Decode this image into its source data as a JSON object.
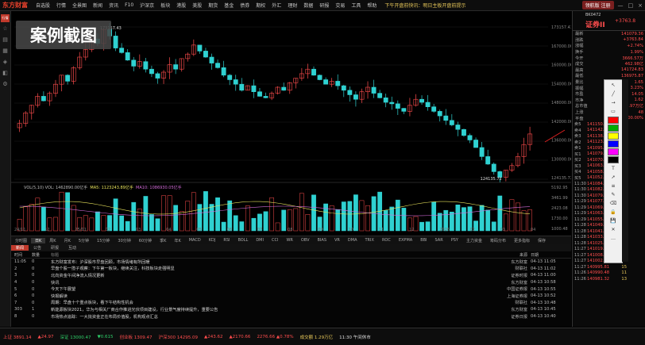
{
  "app": {
    "logo": "东方财富",
    "window_buttons": [
      "—",
      "□",
      "×"
    ],
    "brand_button": "领航版 注册",
    "ticker_text": "下午开盘前快讯：明日主板开盘前提示"
  },
  "menu": [
    "自选股",
    "行情",
    "全景图",
    "新闻",
    "资讯",
    "F10",
    "沪深京",
    "板块",
    "港股",
    "美股",
    "期货",
    "基金",
    "债券",
    "期权",
    "外汇",
    "理财",
    "数据",
    "研报",
    "交易",
    "工具",
    "帮助"
  ],
  "overlay": {
    "label": "案例截图"
  },
  "sidebar": {
    "active_icon": "行情"
  },
  "chart": {
    "high_label": "173157.43",
    "low_label": "124135.72",
    "volume_legend": {
      "v1": "VOL(5,10)  VOL: 1462890.00亿手",
      "v2": "MA5: 1123243.89亿手",
      "v3": "MA10: 1086930.05亿手"
    },
    "price_ticks": [
      "173157.43",
      "167000.00",
      "160000.00",
      "154000.00",
      "148000.00",
      "142000.00",
      "136000.00",
      "130000.00",
      "124135.72"
    ],
    "volume_ticks": [
      "5192.95",
      "3461.99",
      "2423.08",
      "1730.00",
      "1000.48"
    ],
    "date_ticks": [
      "24/11",
      "12",
      "25/01",
      "02",
      "03",
      "04",
      "05",
      "06",
      "07",
      "08",
      "09",
      "10",
      "11",
      "12",
      "2026",
      "02",
      "03",
      "04"
    ]
  },
  "chart_data": {
    "type": "candlestick",
    "title": "",
    "xlabel": "",
    "ylabel": "",
    "ylim": [
      124000,
      174000
    ],
    "annotations": {
      "high": 173157.43,
      "low": 124135.72
    },
    "ohlc_close_series": [
      142000,
      145500,
      148000,
      151000,
      149500,
      152000,
      155000,
      158000,
      156000,
      160500,
      164000,
      166500,
      170000,
      168500,
      173157,
      171000,
      167000,
      165500,
      163000,
      161000,
      162500,
      160000,
      158500,
      157000,
      159000,
      161500,
      160000,
      163500,
      165000,
      168000,
      166000,
      164000,
      162000,
      160500,
      158000,
      156500,
      155000,
      153000,
      154500,
      152500,
      151000,
      150500,
      152000,
      154000,
      153000,
      155500,
      157000,
      158500,
      160000,
      158000,
      156500,
      155000,
      156000,
      154500,
      153000,
      151500,
      150000,
      152500,
      154000,
      152000,
      150500,
      149000,
      148500,
      147000,
      146000,
      148000,
      150000,
      149000,
      147500,
      146000,
      144500,
      143000,
      141500,
      140000,
      138000,
      136500,
      134000,
      131000,
      128500,
      126000,
      124136,
      126500,
      128000,
      131000,
      135000,
      138500
    ]
  },
  "chart_tabs": [
    "分时图",
    "日K",
    "周K",
    "月K",
    "5分钟",
    "15分钟",
    "30分钟",
    "60分钟",
    "季K",
    "年K",
    "MACD",
    "KDJ",
    "RSI",
    "BOLL",
    "DMI",
    "CCI",
    "WR",
    "OBV",
    "BIAS",
    "VR",
    "DMA",
    "TRIX",
    "ROC",
    "EXPMA",
    "BBI",
    "SAR",
    "PSY",
    "主力资金",
    "筹码分布",
    "更多指标",
    "保存"
  ],
  "news": {
    "tabs": [
      "新闻",
      "公告",
      "研报",
      "互动"
    ],
    "headers": {
      "time": "时间",
      "count": "数量",
      "title": "标题",
      "source": "来源",
      "date": "日期"
    },
    "items": [
      {
        "time": "11:05",
        "num": "0",
        "title": "东方财富发布：沪深股市早盘回顾，市场情绪有所回暖",
        "source": "东方财富",
        "date": "04-13 11:05"
      },
      {
        "time": "2",
        "num": "0",
        "title": "早盘个股一揽子观察：下午第一板块，继续关注，科技板块走强明显",
        "source": "财联社",
        "date": "04-13 11:02"
      },
      {
        "time": "3",
        "num": "0",
        "title": "北向资金午间净流入情况更新",
        "source": "证券时报",
        "date": "04-13 11:00"
      },
      {
        "time": "4",
        "num": "0",
        "title": "快讯",
        "source": "东方财富",
        "date": "04-13 10:58"
      },
      {
        "time": "5",
        "num": "0",
        "title": "今天下午展望",
        "source": "中国证券报",
        "date": "04-13 10:55"
      },
      {
        "time": "6",
        "num": "0",
        "title": "快报解读",
        "source": "上海证券报",
        "date": "04-13 10:52"
      },
      {
        "time": "7",
        "num": "0",
        "title": "周期：早盘十个重点板块，看下午结构性机会",
        "source": "财联社",
        "date": "04-13 10:48"
      },
      {
        "time": "303",
        "num": "1",
        "title": "新能源板块2021，华为与相关厂商合作推进光伏项目建设，行业景气度持续提升，重要公告",
        "source": "东方财富",
        "date": "04-13 10:45"
      },
      {
        "time": "8",
        "num": "0",
        "title": "市场热点追踪：一大批资金正在布局价值股，机构观点汇总",
        "source": "证券日报",
        "date": "04-13 10:40"
      }
    ]
  },
  "status": {
    "items": [
      {
        "text": "上证 3891.14",
        "tone": "red"
      },
      {
        "text": "▲24.97",
        "tone": "red"
      },
      {
        "text": "深证 13000.47",
        "tone": "green"
      },
      {
        "text": "▼0.615",
        "tone": "green"
      },
      {
        "text": "创业板 1309.47",
        "tone": "red"
      },
      {
        "text": "沪深300 14295.09",
        "tone": "red"
      },
      {
        "text": "▲243.62",
        "tone": "red"
      },
      {
        "text": "▲2170.66",
        "tone": "red"
      },
      {
        "text": "2276.66 ▲0.78%",
        "tone": "red"
      },
      {
        "text": "成交额 1.29万亿",
        "tone": "yellow"
      },
      {
        "text": "11:30 午间休市",
        "tone": "white"
      }
    ]
  },
  "right_panel": {
    "code": "BK0472",
    "name": "证券II",
    "price_big": "141079.36",
    "change": "+3763.8",
    "pct": "+2.74%",
    "stats": [
      {
        "label": "最新",
        "value": "141079.36"
      },
      {
        "label": "涨跌",
        "value": "+3763.84"
      },
      {
        "label": "涨幅",
        "value": "+2.74%"
      },
      {
        "label": "换手",
        "value": "1.99%"
      },
      {
        "label": "今开",
        "value": "3666.57万"
      },
      {
        "label": "成交",
        "value": "462.98亿"
      },
      {
        "label": "最高",
        "value": "141724.83"
      },
      {
        "label": "最低",
        "value": "136975.87"
      },
      {
        "label": "量比",
        "value": "1.65"
      },
      {
        "label": "振幅",
        "value": "3.23%"
      },
      {
        "label": "市盈",
        "value": "14.05"
      },
      {
        "label": "市净",
        "value": "1.62"
      },
      {
        "label": "总市值",
        "value": "2.97万亿"
      },
      {
        "label": "上涨",
        "value": "48"
      },
      {
        "label": "平盘",
        "value": "100.00%"
      }
    ],
    "orderbook": [
      {
        "lbl": "卖5",
        "px": "141150.74",
        "qty": "13"
      },
      {
        "lbl": "卖4",
        "px": "141142.97",
        "qty": "13"
      },
      {
        "lbl": "卖3",
        "px": "141138.62",
        "qty": "12"
      },
      {
        "lbl": "卖2",
        "px": "141123.11",
        "qty": "13"
      },
      {
        "lbl": "卖1",
        "px": "141095.20",
        "qty": "11"
      },
      {
        "lbl": "买1",
        "px": "141079.36",
        "qty": "16"
      },
      {
        "lbl": "买2",
        "px": "141070.48",
        "qty": "20"
      },
      {
        "lbl": "买3",
        "px": "141063.27",
        "qty": "26"
      },
      {
        "lbl": "买4",
        "px": "141058.50",
        "qty": "15"
      },
      {
        "lbl": "买5",
        "px": "141052.81",
        "qty": "19"
      },
      {
        "lbl": "11:30",
        "px": "141084.20",
        "qty": "13"
      },
      {
        "lbl": "11:30",
        "px": "141082.94",
        "qty": "11"
      },
      {
        "lbl": "11:30",
        "px": "141079.36",
        "qty": "11"
      },
      {
        "lbl": "11:29",
        "px": "141077.90",
        "qty": "12"
      },
      {
        "lbl": "11:29",
        "px": "141069.44",
        "qty": "11"
      },
      {
        "lbl": "11:29",
        "px": "141063.91",
        "qty": "13"
      },
      {
        "lbl": "11:29",
        "px": "141055.56",
        "qty": "13"
      },
      {
        "lbl": "11:28",
        "px": "141049.02",
        "qty": "11"
      },
      {
        "lbl": "11:28",
        "px": "141041.69",
        "qty": "15"
      },
      {
        "lbl": "11:28",
        "px": "141033.45",
        "qty": "10"
      },
      {
        "lbl": "11:28",
        "px": "141025.76",
        "qty": "13"
      },
      {
        "lbl": "11:27",
        "px": "141019.00",
        "qty": "13"
      },
      {
        "lbl": "11:27",
        "px": "141008.58",
        "qty": "11"
      },
      {
        "lbl": "11:27",
        "px": "141002.80",
        "qty": "15"
      },
      {
        "lbl": "11:27",
        "px": "140995.81",
        "qty": "15"
      },
      {
        "lbl": "11:26",
        "px": "140990.48",
        "qty": "11"
      },
      {
        "lbl": "11:26",
        "px": "140981.32",
        "qty": "13"
      }
    ],
    "colors": {
      "up": "#ff4d4d",
      "down": "#2fd16a",
      "accent": "#c0392b"
    }
  },
  "draw_toolbar": {
    "swatches": [
      "#ff0000",
      "#00aa00",
      "#ffff00",
      "#0000ff",
      "#ff00ff",
      "#000000"
    ],
    "tools": [
      "pointer-icon",
      "line-icon",
      "ray-icon",
      "rect-icon",
      "text-icon",
      "arrow-icon",
      "fib-icon",
      "pen-icon",
      "eraser-icon",
      "lock-icon",
      "save-icon",
      "delete-icon",
      "more-icon"
    ]
  }
}
